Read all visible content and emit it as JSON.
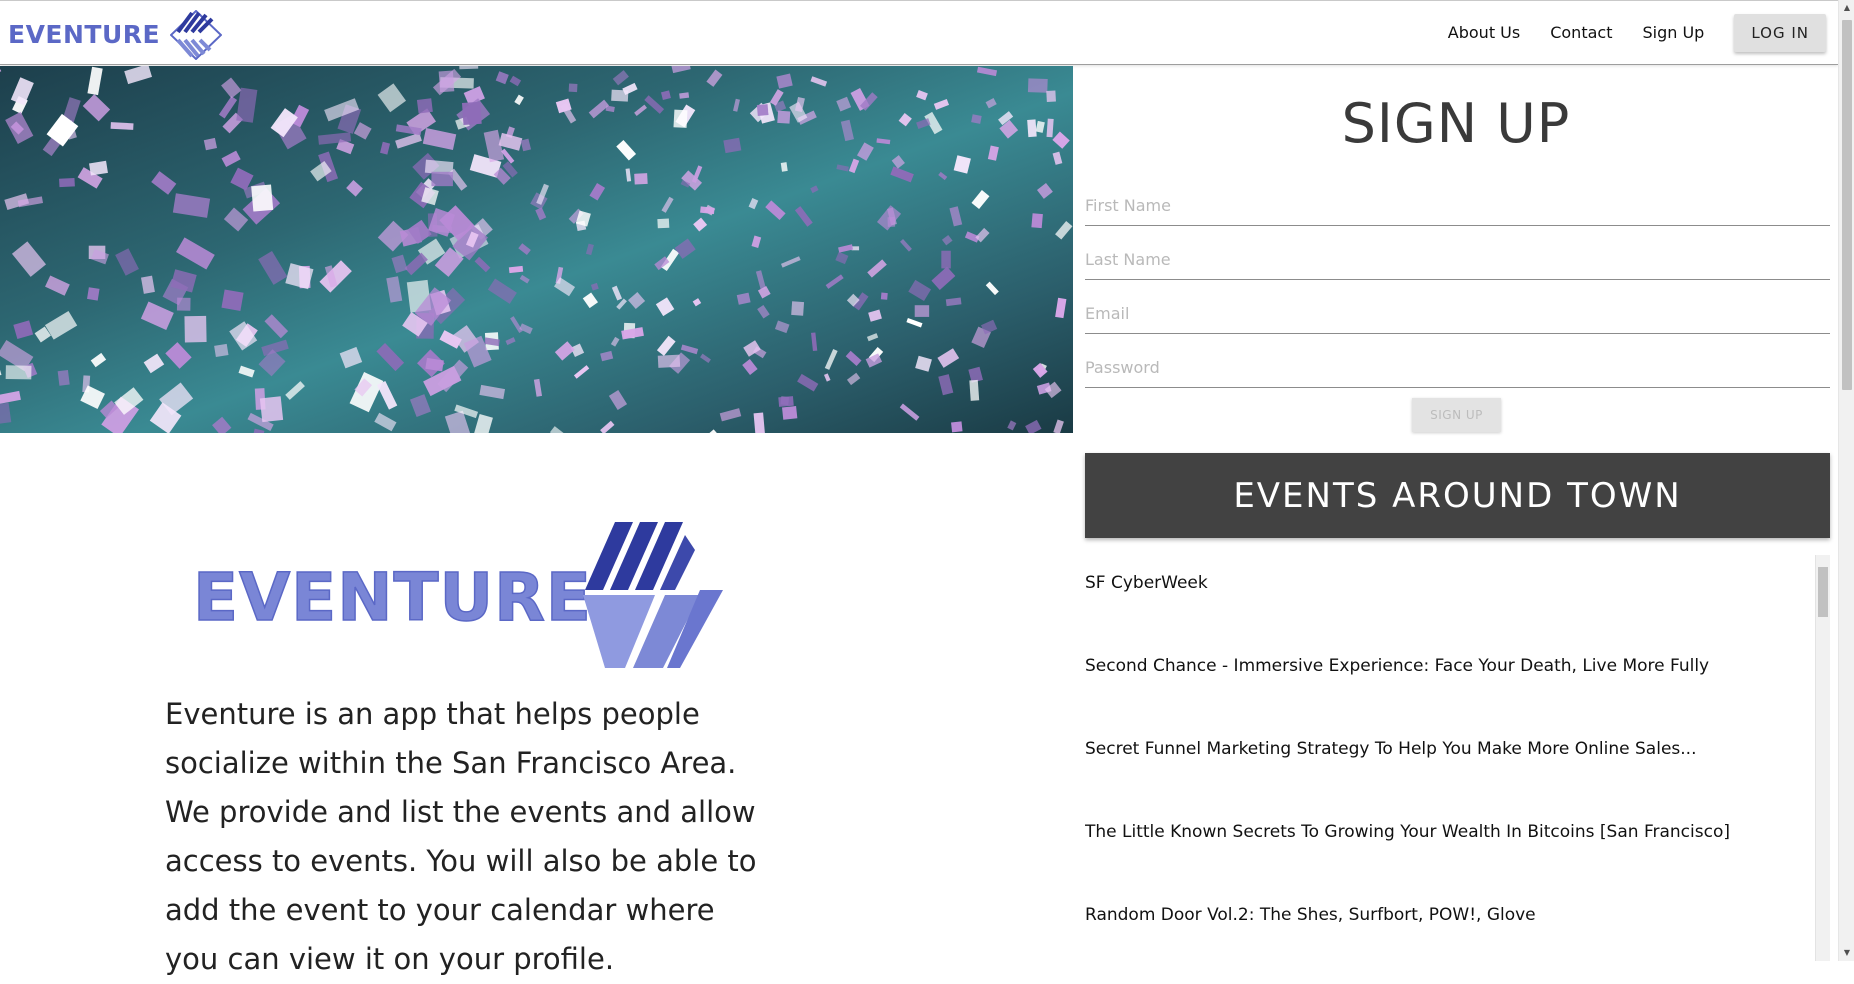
{
  "brand": {
    "name": "EVENTURE"
  },
  "nav": {
    "links": [
      "About Us",
      "Contact",
      "Sign Up"
    ],
    "login_label": "LOG IN"
  },
  "signup": {
    "title": "SIGN UP",
    "first_name_placeholder": "First Name",
    "last_name_placeholder": "Last Name",
    "email_placeholder": "Email",
    "password_placeholder": "Password",
    "button_label": "SIGN UP"
  },
  "events": {
    "title": "EVENTS AROUND TOWN",
    "items": [
      "SF CyberWeek",
      "Second Chance - Immersive Experience: Face Your Death, Live More Fully",
      "Secret Funnel Marketing Strategy To Help You Make More Online Sales...",
      "The Little Known Secrets To Growing Your Wealth In Bitcoins [San Francisco]",
      "Random Door Vol.2: The Shes, Surfbort, POW!, Glove"
    ]
  },
  "about": {
    "logo_text": "EVENTURE",
    "text": "Eventure is an app that helps people socialize within the San Francisco Area. We provide and list the events and allow access to events. You will also be able to add the event to your calendar where you can view it on your profile."
  },
  "colors": {
    "brand": "#5b68c6",
    "brand_dark": "#2e3a9e",
    "events_header": "#424242"
  },
  "icons": {
    "logo": "eventure-logo-icon"
  }
}
